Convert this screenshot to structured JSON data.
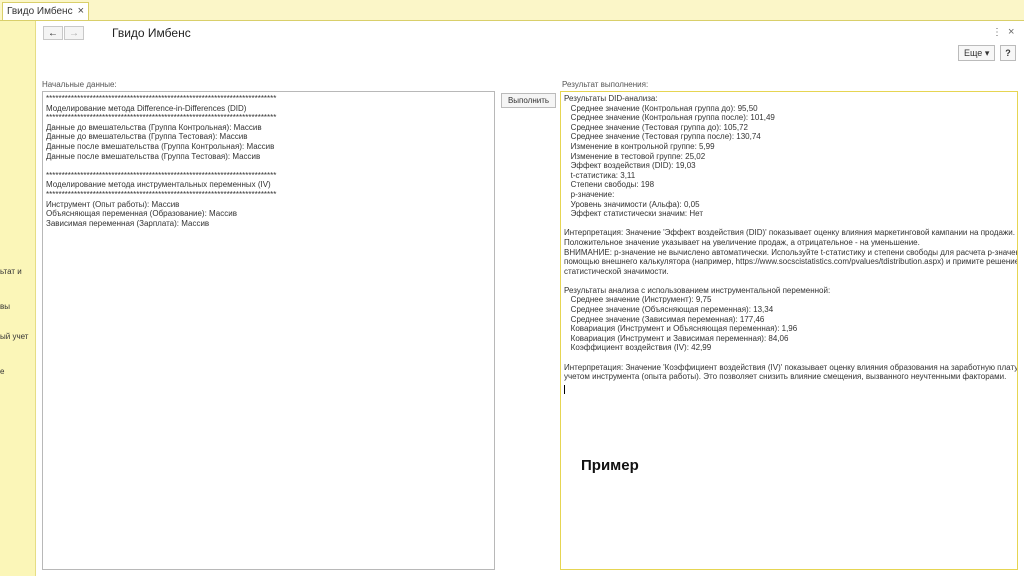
{
  "tab": {
    "label": "Гвидо Имбенс",
    "close": "×"
  },
  "sidebar": {
    "items": [
      "ьтат и",
      "вы",
      "ый учет",
      "е"
    ]
  },
  "window": {
    "title": "Гвидо Имбенс",
    "kebab": "⋮",
    "close": "×"
  },
  "nav": {
    "back": "←",
    "forward": "→"
  },
  "toolbar": {
    "more": "Еще ▾",
    "help": "?"
  },
  "left": {
    "label": "Начальные данные:",
    "lines": [
      "**************************************************************************",
      "Моделирование метода Difference-in-Differences (DID)",
      "**************************************************************************",
      "Данные до вмешательства (Группа Контрольная): Массив",
      "Данные до вмешательства (Группа Тестовая): Массив",
      "Данные после вмешательства (Группа Контрольная): Массив",
      "Данные после вмешательства (Группа Тестовая): Массив",
      "",
      "**************************************************************************",
      "Моделирование метода инструментальных переменных (IV)",
      "**************************************************************************",
      "Инструмент (Опыт работы): Массив",
      "Объясняющая переменная (Образование): Массив",
      "Зависимая переменная (Зарплата): Массив"
    ]
  },
  "run_button": "Выполнить",
  "right": {
    "label": "Результат выполнения:",
    "lines": [
      "Результаты DID-анализа:",
      "   Среднее значение (Контрольная группа до): 95,50",
      "   Среднее значение (Контрольная группа после): 101,49",
      "   Среднее значение (Тестовая группа до): 105,72",
      "   Среднее значение (Тестовая группа после): 130,74",
      "   Изменение в контрольной группе: 5,99",
      "   Изменение в тестовой группе: 25,02",
      "   Эффект воздействия (DID): 19,03",
      "   t-статистика: 3,11",
      "   Степени свободы: 198",
      "   p-значение:",
      "   Уровень значимости (Альфа): 0,05",
      "   Эффект статистически значим: Нет",
      "",
      "Интерпретация: Значение 'Эффект воздействия (DID)' показывает оценку влияния маркетинговой кампании на продажи.",
      "Положительное значение указывает на увеличение продаж, а отрицательное - на уменьшение.",
      "ВНИМАНИЕ: p-значение не вычислено автоматически. Используйте t-статистику и степени свободы для расчета p-значения с",
      "помощью внешнего калькулятора (например, https://www.socscistatistics.com/pvalues/tdistribution.aspx) и примите решение о",
      "статистической значимости.",
      "",
      "Результаты анализа с использованием инструментальной переменной:",
      "   Среднее значение (Инструмент): 9,75",
      "   Среднее значение (Объясняющая переменная): 13,34",
      "   Среднее значение (Зависимая переменная): 177,46",
      "   Ковариация (Инструмент и Объясняющая переменная): 1,96",
      "   Ковариация (Инструмент и Зависимая переменная): 84,06",
      "   Коэффициент воздействия (IV): 42,99",
      "",
      "Интерпретация: Значение 'Коэффициент воздействия (IV)' показывает оценку влияния образования на заработную плату с",
      "учетом инструмента (опыта работы). Это позволяет снизить влияние смещения, вызванного неучтенными факторами."
    ]
  },
  "example_label": "Пример"
}
